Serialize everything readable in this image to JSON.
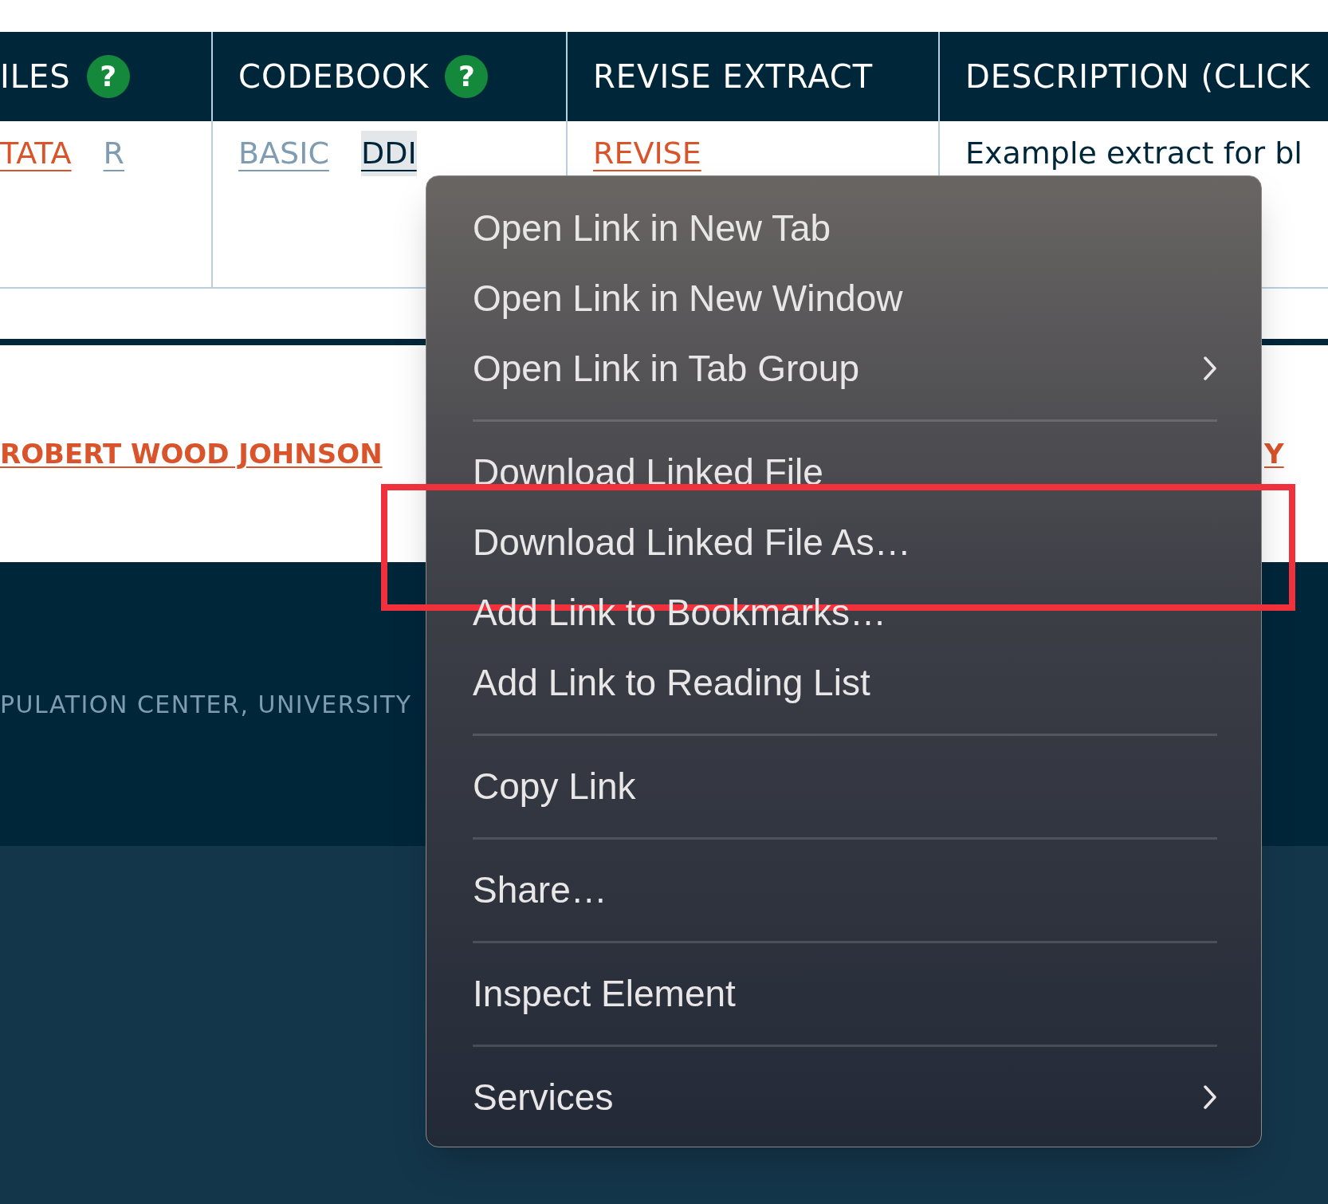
{
  "table": {
    "columns": [
      {
        "label": "ILES",
        "help": "?"
      },
      {
        "label": "CODEBOOK",
        "help": "?"
      },
      {
        "label": "REVISE EXTRACT"
      },
      {
        "label": "DESCRIPTION (CLICK"
      }
    ],
    "cells": [
      {
        "links": [
          {
            "text": "TATA",
            "kind": "accent",
            "focused": false
          },
          {
            "text": "R",
            "kind": "muted",
            "focused": false
          }
        ]
      },
      {
        "links": [
          {
            "text": "BASIC",
            "kind": "muted",
            "focused": false
          },
          {
            "text": "DDI",
            "kind": "dark",
            "focused": true
          }
        ]
      },
      {
        "links": [
          {
            "text": "REVISE",
            "kind": "accent",
            "focused": false
          }
        ]
      },
      {
        "text": "Example extract for bl"
      }
    ]
  },
  "sponsor_links": [
    {
      "text": "ROBERT WOOD JOHNSON"
    },
    {
      "text": "Y"
    }
  ],
  "footer": {
    "text": "PULATION CENTER, UNIVERSITY"
  },
  "context_menu": {
    "items": [
      {
        "kind": "item",
        "label": "Open Link in New Tab",
        "submenu": false,
        "outlined": false
      },
      {
        "kind": "item",
        "label": "Open Link in New Window",
        "submenu": false,
        "outlined": false
      },
      {
        "kind": "item",
        "label": "Open Link in Tab Group",
        "submenu": true,
        "outlined": false
      },
      {
        "kind": "separator"
      },
      {
        "kind": "item",
        "label": "Download Linked File",
        "submenu": false,
        "outlined": false
      },
      {
        "kind": "item",
        "label": "Download Linked File As…",
        "submenu": false,
        "outlined": true
      },
      {
        "kind": "item",
        "label": "Add Link to Bookmarks…",
        "submenu": false,
        "outlined": false
      },
      {
        "kind": "item",
        "label": "Add Link to Reading List",
        "submenu": false,
        "outlined": false
      },
      {
        "kind": "separator"
      },
      {
        "kind": "item",
        "label": "Copy Link",
        "submenu": false,
        "outlined": false
      },
      {
        "kind": "separator"
      },
      {
        "kind": "item",
        "label": "Share…",
        "submenu": false,
        "outlined": false
      },
      {
        "kind": "separator"
      },
      {
        "kind": "item",
        "label": "Inspect Element",
        "submenu": false,
        "outlined": false
      },
      {
        "kind": "separator"
      },
      {
        "kind": "item",
        "label": "Services",
        "submenu": true,
        "outlined": false
      }
    ]
  }
}
